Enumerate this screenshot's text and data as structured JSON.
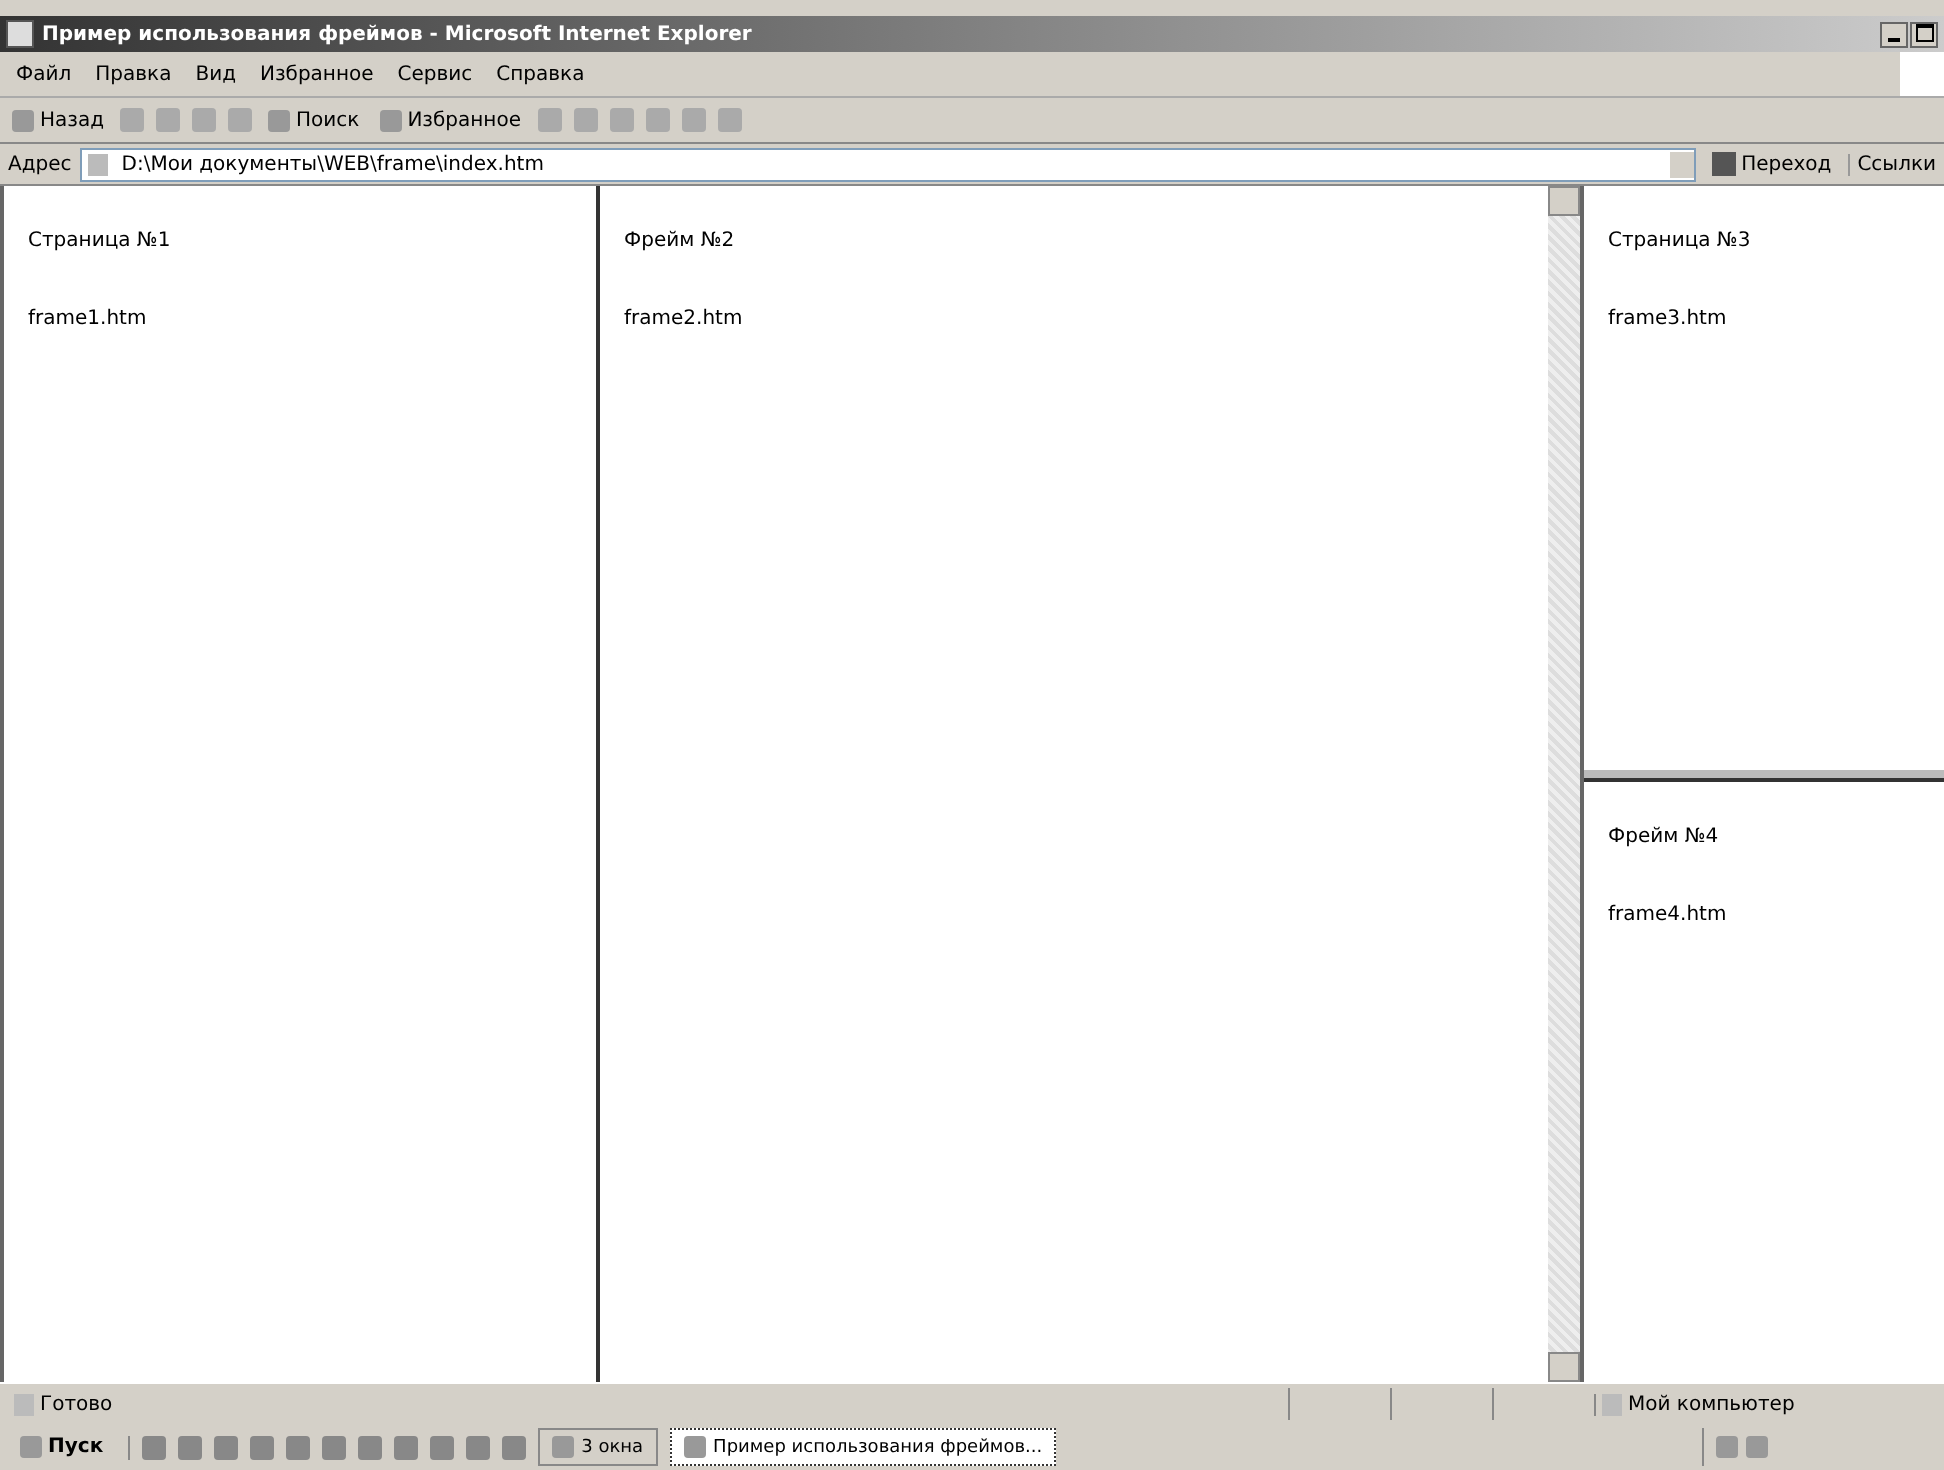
{
  "window": {
    "title": "Пример использования фреймов - Microsoft Internet Explorer"
  },
  "menu": [
    "Файл",
    "Правка",
    "Вид",
    "Избранное",
    "Сервис",
    "Справка"
  ],
  "toolbar": [
    {
      "kind": "labeled",
      "label": "Назад"
    },
    {
      "kind": "icon"
    },
    {
      "kind": "icon"
    },
    {
      "kind": "icon"
    },
    {
      "kind": "icon"
    },
    {
      "kind": "labeled",
      "label": "Поиск"
    },
    {
      "kind": "labeled",
      "label": "Избранное"
    },
    {
      "kind": "icon"
    },
    {
      "kind": "icon"
    },
    {
      "kind": "icon"
    },
    {
      "kind": "icon"
    },
    {
      "kind": "icon"
    },
    {
      "kind": "icon"
    }
  ],
  "address": {
    "label": "Адрес",
    "value": "D:\\Мои документы\\WEB\\frame\\index.htm",
    "go": "Переход",
    "links": "Ссылки"
  },
  "frames": [
    {
      "heading": "Страница №1",
      "text": "frame1.htm"
    },
    {
      "heading": "Фрейм №2",
      "text": "frame2.htm"
    },
    {
      "heading": "Страница №3",
      "text": "frame3.htm"
    },
    {
      "heading": "Фрейм №4",
      "text": "frame4.htm"
    }
  ],
  "status_bar": {
    "left": "Готово",
    "right": "Мой компьютер"
  },
  "taskbar": {
    "start": "Пуск",
    "tasks": [
      {
        "label": "3 окна",
        "selected": false
      },
      {
        "label": "Пример использования фреймов...",
        "selected": true
      }
    ]
  }
}
